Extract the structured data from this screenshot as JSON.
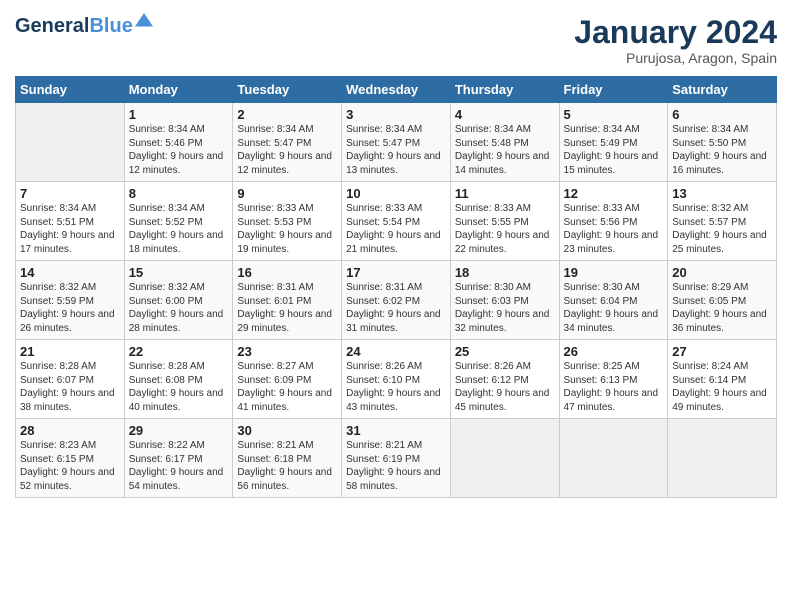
{
  "header": {
    "logo_line1": "General",
    "logo_line2": "Blue",
    "month": "January 2024",
    "location": "Purujosa, Aragon, Spain"
  },
  "weekdays": [
    "Sunday",
    "Monday",
    "Tuesday",
    "Wednesday",
    "Thursday",
    "Friday",
    "Saturday"
  ],
  "weeks": [
    [
      {
        "num": "",
        "sunrise": "",
        "sunset": "",
        "daylight": ""
      },
      {
        "num": "1",
        "sunrise": "Sunrise: 8:34 AM",
        "sunset": "Sunset: 5:46 PM",
        "daylight": "Daylight: 9 hours and 12 minutes."
      },
      {
        "num": "2",
        "sunrise": "Sunrise: 8:34 AM",
        "sunset": "Sunset: 5:47 PM",
        "daylight": "Daylight: 9 hours and 12 minutes."
      },
      {
        "num": "3",
        "sunrise": "Sunrise: 8:34 AM",
        "sunset": "Sunset: 5:47 PM",
        "daylight": "Daylight: 9 hours and 13 minutes."
      },
      {
        "num": "4",
        "sunrise": "Sunrise: 8:34 AM",
        "sunset": "Sunset: 5:48 PM",
        "daylight": "Daylight: 9 hours and 14 minutes."
      },
      {
        "num": "5",
        "sunrise": "Sunrise: 8:34 AM",
        "sunset": "Sunset: 5:49 PM",
        "daylight": "Daylight: 9 hours and 15 minutes."
      },
      {
        "num": "6",
        "sunrise": "Sunrise: 8:34 AM",
        "sunset": "Sunset: 5:50 PM",
        "daylight": "Daylight: 9 hours and 16 minutes."
      }
    ],
    [
      {
        "num": "7",
        "sunrise": "Sunrise: 8:34 AM",
        "sunset": "Sunset: 5:51 PM",
        "daylight": "Daylight: 9 hours and 17 minutes."
      },
      {
        "num": "8",
        "sunrise": "Sunrise: 8:34 AM",
        "sunset": "Sunset: 5:52 PM",
        "daylight": "Daylight: 9 hours and 18 minutes."
      },
      {
        "num": "9",
        "sunrise": "Sunrise: 8:33 AM",
        "sunset": "Sunset: 5:53 PM",
        "daylight": "Daylight: 9 hours and 19 minutes."
      },
      {
        "num": "10",
        "sunrise": "Sunrise: 8:33 AM",
        "sunset": "Sunset: 5:54 PM",
        "daylight": "Daylight: 9 hours and 21 minutes."
      },
      {
        "num": "11",
        "sunrise": "Sunrise: 8:33 AM",
        "sunset": "Sunset: 5:55 PM",
        "daylight": "Daylight: 9 hours and 22 minutes."
      },
      {
        "num": "12",
        "sunrise": "Sunrise: 8:33 AM",
        "sunset": "Sunset: 5:56 PM",
        "daylight": "Daylight: 9 hours and 23 minutes."
      },
      {
        "num": "13",
        "sunrise": "Sunrise: 8:32 AM",
        "sunset": "Sunset: 5:57 PM",
        "daylight": "Daylight: 9 hours and 25 minutes."
      }
    ],
    [
      {
        "num": "14",
        "sunrise": "Sunrise: 8:32 AM",
        "sunset": "Sunset: 5:59 PM",
        "daylight": "Daylight: 9 hours and 26 minutes."
      },
      {
        "num": "15",
        "sunrise": "Sunrise: 8:32 AM",
        "sunset": "Sunset: 6:00 PM",
        "daylight": "Daylight: 9 hours and 28 minutes."
      },
      {
        "num": "16",
        "sunrise": "Sunrise: 8:31 AM",
        "sunset": "Sunset: 6:01 PM",
        "daylight": "Daylight: 9 hours and 29 minutes."
      },
      {
        "num": "17",
        "sunrise": "Sunrise: 8:31 AM",
        "sunset": "Sunset: 6:02 PM",
        "daylight": "Daylight: 9 hours and 31 minutes."
      },
      {
        "num": "18",
        "sunrise": "Sunrise: 8:30 AM",
        "sunset": "Sunset: 6:03 PM",
        "daylight": "Daylight: 9 hours and 32 minutes."
      },
      {
        "num": "19",
        "sunrise": "Sunrise: 8:30 AM",
        "sunset": "Sunset: 6:04 PM",
        "daylight": "Daylight: 9 hours and 34 minutes."
      },
      {
        "num": "20",
        "sunrise": "Sunrise: 8:29 AM",
        "sunset": "Sunset: 6:05 PM",
        "daylight": "Daylight: 9 hours and 36 minutes."
      }
    ],
    [
      {
        "num": "21",
        "sunrise": "Sunrise: 8:28 AM",
        "sunset": "Sunset: 6:07 PM",
        "daylight": "Daylight: 9 hours and 38 minutes."
      },
      {
        "num": "22",
        "sunrise": "Sunrise: 8:28 AM",
        "sunset": "Sunset: 6:08 PM",
        "daylight": "Daylight: 9 hours and 40 minutes."
      },
      {
        "num": "23",
        "sunrise": "Sunrise: 8:27 AM",
        "sunset": "Sunset: 6:09 PM",
        "daylight": "Daylight: 9 hours and 41 minutes."
      },
      {
        "num": "24",
        "sunrise": "Sunrise: 8:26 AM",
        "sunset": "Sunset: 6:10 PM",
        "daylight": "Daylight: 9 hours and 43 minutes."
      },
      {
        "num": "25",
        "sunrise": "Sunrise: 8:26 AM",
        "sunset": "Sunset: 6:12 PM",
        "daylight": "Daylight: 9 hours and 45 minutes."
      },
      {
        "num": "26",
        "sunrise": "Sunrise: 8:25 AM",
        "sunset": "Sunset: 6:13 PM",
        "daylight": "Daylight: 9 hours and 47 minutes."
      },
      {
        "num": "27",
        "sunrise": "Sunrise: 8:24 AM",
        "sunset": "Sunset: 6:14 PM",
        "daylight": "Daylight: 9 hours and 49 minutes."
      }
    ],
    [
      {
        "num": "28",
        "sunrise": "Sunrise: 8:23 AM",
        "sunset": "Sunset: 6:15 PM",
        "daylight": "Daylight: 9 hours and 52 minutes."
      },
      {
        "num": "29",
        "sunrise": "Sunrise: 8:22 AM",
        "sunset": "Sunset: 6:17 PM",
        "daylight": "Daylight: 9 hours and 54 minutes."
      },
      {
        "num": "30",
        "sunrise": "Sunrise: 8:21 AM",
        "sunset": "Sunset: 6:18 PM",
        "daylight": "Daylight: 9 hours and 56 minutes."
      },
      {
        "num": "31",
        "sunrise": "Sunrise: 8:21 AM",
        "sunset": "Sunset: 6:19 PM",
        "daylight": "Daylight: 9 hours and 58 minutes."
      },
      {
        "num": "",
        "sunrise": "",
        "sunset": "",
        "daylight": ""
      },
      {
        "num": "",
        "sunrise": "",
        "sunset": "",
        "daylight": ""
      },
      {
        "num": "",
        "sunrise": "",
        "sunset": "",
        "daylight": ""
      }
    ]
  ]
}
